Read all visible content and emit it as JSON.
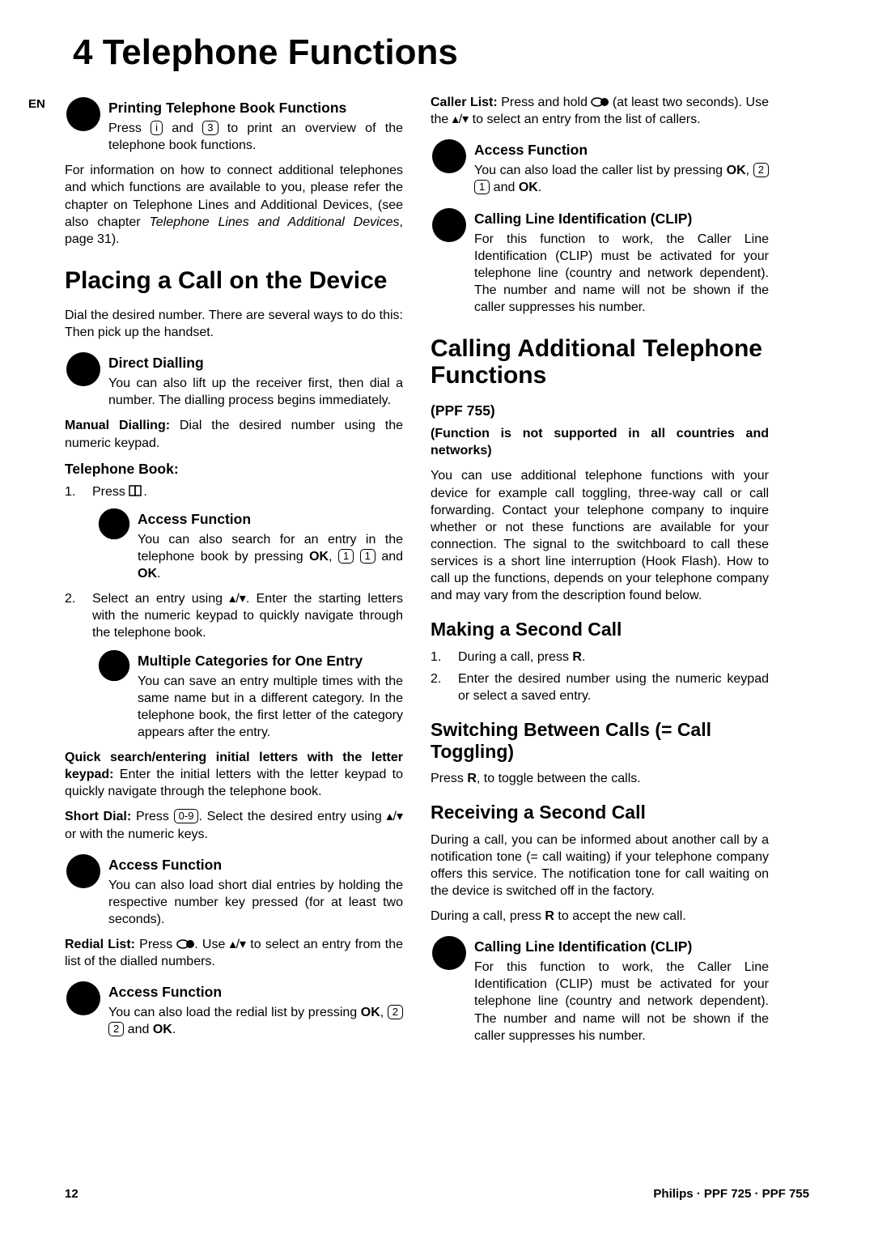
{
  "lang_marker": "EN",
  "chapter_title": "4 Telephone Functions",
  "footer": {
    "pagenum": "12",
    "product": "Philips · PPF 725 · PPF 755"
  },
  "lc": {
    "info_print": {
      "title": "Printing Telephone Book Functions",
      "pre": "Press ",
      "key1": "i",
      "mid": " and ",
      "key2": "3",
      "post": " to print an overview of the telephone book functions."
    },
    "para_info": {
      "pre": "For information on how to connect additional telephones and which functions are available to you, please refer the chapter on Telephone Lines and Additional Devices, (see also chapter ",
      "ital": "Telephone Lines and Additional Devices",
      "post": ", page 31)."
    },
    "h_placing": "Placing a Call on the Device",
    "p_dial": "Dial the desired number. There are several ways to do this: Then pick up the handset.",
    "info_direct": {
      "title": "Direct Dialling",
      "body": "You can also lift up the receiver first, then dial a number. The dialling process begins immediately."
    },
    "manual": {
      "label": "Manual Dialling:",
      "body": " Dial the desired number using the numeric keypad."
    },
    "tb_label": "Telephone Book:",
    "li1_pre": "Press ",
    "li1_icon": "☐☐",
    "li1_post": ".",
    "info_access1": {
      "title": "Access Function",
      "pre": "You can also search for an entry in the telephone book by pressing ",
      "ok1": "OK",
      "c": ", ",
      "k1": "1",
      "k2": "1",
      "and": " and ",
      "ok2": "OK",
      "dot": "."
    },
    "li2_pre": "Select an entry using ",
    "li2_sym": "▴/▾",
    "li2_post": ". Enter the starting letters with the numeric keypad to quickly navigate through the telephone book.",
    "info_mult": {
      "title": "Multiple Categories for One Entry",
      "body": "You can save an entry multiple times with the same name but in a different category. In the telephone book, the first letter of the category appears after the entry."
    },
    "quick": {
      "label": "Quick search/entering initial letters with the letter keypad:",
      "body": " Enter the initial letters with the letter keypad to quickly navigate through the telephone book."
    },
    "short": {
      "label": "Short Dial:",
      "pre": " Press ",
      "key": "0-9",
      "mid": ". Select the desired entry using ",
      "sym": "▴/▾",
      "post": " or with the numeric keys."
    },
    "info_access2": {
      "title": "Access Function",
      "body": "You can also load short dial entries by holding the respective number key pressed (for at least two seconds)."
    },
    "redial": {
      "label": "Redial List:",
      "pre": " Press ",
      "icon": "◯●",
      "mid": ". Use ",
      "sym": "▴/▾",
      "post": " to select an entry from the list of the dialled numbers."
    },
    "info_access3": {
      "title": "Access Function",
      "pre": "You can also load the redial list by pressing ",
      "ok1": "OK",
      "c": ", ",
      "k1": "2",
      "k2": "2",
      "and": " and ",
      "ok2": "OK",
      "dot": "."
    }
  },
  "rc": {
    "caller": {
      "label": "Caller List:",
      "pre": " Press and hold ",
      "icon": "◯●",
      "mid": " (at least two seconds). Use the ",
      "sym": "▴/▾",
      "post": " to select an entry from the list of callers."
    },
    "info_access4": {
      "title": "Access Function",
      "pre": "You can also load the caller list by pressing ",
      "ok1": "OK",
      "c": ", ",
      "k1": "2",
      "k2": "1",
      "and": " and ",
      "ok2": "OK",
      "dot": "."
    },
    "info_clip1": {
      "title": "Calling Line Identification (CLIP)",
      "body": "For this function to work, the Caller Line Identification (CLIP) must be activated for your telephone line (country and network dependent). The number and name will not be shown if the caller suppresses his number."
    },
    "h_calling": "Calling Additional Telephone Functions",
    "model": "(PPF 755)",
    "support": "(Function is not supported in all countries and networks)",
    "p_use": "You can use additional telephone functions with your device for example call toggling, three-way call or call forwarding. Contact your telephone company to inquire whether or not these functions are available for your connection. The signal to the switchboard to call these services is a short line interruption (Hook Flash). How to call up the functions, depends on your telephone company and may vary from the description found below.",
    "h_making": "Making a Second Call",
    "m1_pre": "During a call, press ",
    "m1_r": "R",
    "m1_post": ".",
    "m2": "Enter the desired number using the numeric keypad or select a saved entry.",
    "h_switch": "Switching Between Calls (= Call Toggling)",
    "switch_pre": "Press ",
    "switch_r": "R",
    "switch_post": ", to toggle between the calls.",
    "h_receive": "Receiving a Second Call",
    "p_receive": "During a call, you can be informed about another call by a notification tone (= call waiting) if your telephone company offers this service. The notification tone for call waiting on the device is switched off in the factory.",
    "p_receive2_pre": "During a call, press ",
    "p_receive2_r": "R",
    "p_receive2_post": " to accept the new call.",
    "info_clip2": {
      "title": "Calling Line Identification (CLIP)",
      "body": "For this function to work, the Caller Line Identification (CLIP) must be activated for your telephone line (country and network dependent). The number and name will not be shown if the caller suppresses his number."
    }
  }
}
